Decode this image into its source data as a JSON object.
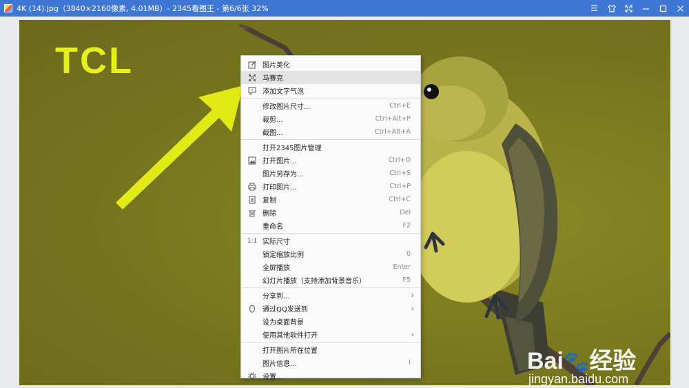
{
  "titlebar": {
    "title": "4K (14).jpg（3840×2160像素, 4.01MB）- 2345看图王 - 第6/6张 32%",
    "controls": [
      "menu-icon",
      "skin-icon",
      "fullscreen-icon",
      "minimize-icon",
      "maximize-icon",
      "close-icon"
    ]
  },
  "image": {
    "logo_text": "TCL",
    "watermark_brand": "Bai",
    "watermark_brand_cn": "经验",
    "watermark_url": "jingyan.baidu.com"
  },
  "menu": {
    "items": [
      {
        "label": "图片美化",
        "shortcut": "",
        "icon": "edit-icon"
      },
      {
        "label": "马赛克",
        "shortcut": "",
        "icon": "mosaic-icon",
        "hover": true
      },
      {
        "label": "添加文字气泡",
        "shortcut": "",
        "icon": "text-bubble-icon"
      },
      {
        "label": "修改图片尺寸...",
        "shortcut": "Ctrl+E",
        "icon": ""
      },
      {
        "label": "裁剪...",
        "shortcut": "Ctrl+Alt+P",
        "icon": ""
      },
      {
        "label": "截图...",
        "shortcut": "Ctrl+Alt+A",
        "icon": ""
      },
      {
        "label": "打开2345图片管理",
        "shortcut": "",
        "icon": ""
      },
      {
        "label": "打开图片...",
        "shortcut": "Ctrl+O",
        "icon": "image-icon"
      },
      {
        "label": "图片另存为...",
        "shortcut": "Ctrl+S",
        "icon": ""
      },
      {
        "label": "打印图片...",
        "shortcut": "Ctrl+P",
        "icon": "printer-icon"
      },
      {
        "label": "复制",
        "shortcut": "Ctrl+C",
        "icon": "copy-icon"
      },
      {
        "label": "删除",
        "shortcut": "Del",
        "icon": "trash-icon"
      },
      {
        "label": "重命名",
        "shortcut": "F2",
        "icon": ""
      },
      {
        "label": "实际尺寸",
        "shortcut": "",
        "icon": "actual-size-icon"
      },
      {
        "label": "锁定缩放比例",
        "shortcut": "0",
        "icon": ""
      },
      {
        "label": "全屏播放",
        "shortcut": "Enter",
        "icon": ""
      },
      {
        "label": "幻灯片播放（支持添加背景音乐）",
        "shortcut": "F5",
        "icon": ""
      },
      {
        "label": "分享到...",
        "shortcut": "",
        "icon": "",
        "submenu": true
      },
      {
        "label": "通过QQ发送到",
        "shortcut": "",
        "icon": "qq-icon",
        "submenu": true
      },
      {
        "label": "设为桌面背景",
        "shortcut": "",
        "icon": ""
      },
      {
        "label": "使用其他软件打开",
        "shortcut": "",
        "icon": "",
        "submenu": true
      },
      {
        "label": "打开图片所在位置",
        "shortcut": "",
        "icon": ""
      },
      {
        "label": "图片信息...",
        "shortcut": "I",
        "icon": ""
      },
      {
        "label": "设置...",
        "shortcut": "",
        "icon": "gear-icon"
      }
    ],
    "separators_after": [
      2,
      5,
      12,
      16,
      20
    ]
  },
  "colors": {
    "titlebar": "#3f77d4",
    "arrow": "#e1ea14",
    "logo": "#e6ef1b",
    "menu_hover": "#e3e3e3"
  }
}
